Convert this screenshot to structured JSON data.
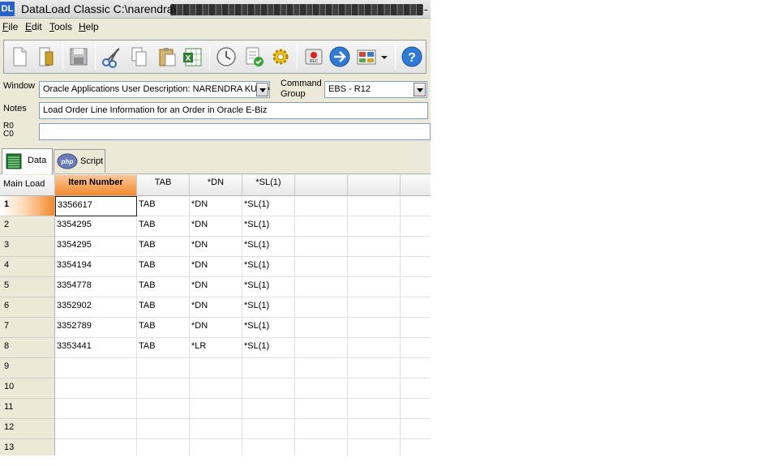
{
  "window": {
    "app_logo": "DL",
    "title": "DataLoad Classic C:\\narendra\\",
    "title_suffix": "-"
  },
  "menu": [
    {
      "label": "File"
    },
    {
      "label": "Edit"
    },
    {
      "label": "Tools"
    },
    {
      "label": "Help"
    }
  ],
  "toolbar": {
    "icons": [
      "new-document-icon",
      "open-icon",
      "save-icon",
      "cut-icon",
      "copy-icon",
      "paste-icon",
      "excel-icon",
      "delay-clock-icon",
      "validate-icon",
      "settings-gear-icon",
      "record-icon",
      "run-arrow-icon",
      "view-options-icon",
      "help-icon"
    ]
  },
  "form": {
    "window_label": "Window",
    "window_value": "Oracle Applications User Description: NARENDRA KUMA",
    "command_group_label_1": "Command",
    "command_group_label_2": "Group",
    "command_group_value": "EBS - R12",
    "notes_label": "Notes",
    "notes_value": "Load Order Line Information for an Order in Oracle E-Biz",
    "row_label": "R0",
    "col_label": "C0",
    "rc_value": ""
  },
  "tabs": [
    {
      "label": "Data",
      "active": true,
      "icon": "data-grid-icon"
    },
    {
      "label": "Script",
      "active": false,
      "icon": "php-icon"
    }
  ],
  "grid": {
    "corner_label": "Main Load",
    "columns": [
      "Item Number",
      "TAB",
      "*DN",
      "*SL(1)",
      "",
      "",
      ""
    ],
    "rows": [
      {
        "num": "1",
        "cells": [
          "3356617",
          "TAB",
          "*DN",
          "*SL(1)",
          "",
          "",
          ""
        ]
      },
      {
        "num": "2",
        "cells": [
          "3354295",
          "TAB",
          "*DN",
          "*SL(1)",
          "",
          "",
          ""
        ]
      },
      {
        "num": "3",
        "cells": [
          "3354295",
          "TAB",
          "*DN",
          "*SL(1)",
          "",
          "",
          ""
        ]
      },
      {
        "num": "4",
        "cells": [
          "3354194",
          "TAB",
          "*DN",
          "*SL(1)",
          "",
          "",
          ""
        ]
      },
      {
        "num": "5",
        "cells": [
          "3354778",
          "TAB",
          "*DN",
          "*SL(1)",
          "",
          "",
          ""
        ]
      },
      {
        "num": "6",
        "cells": [
          "3352902",
          "TAB",
          "*DN",
          "*SL(1)",
          "",
          "",
          ""
        ]
      },
      {
        "num": "7",
        "cells": [
          "3352789",
          "TAB",
          "*DN",
          "*SL(1)",
          "",
          "",
          ""
        ]
      },
      {
        "num": "8",
        "cells": [
          "3353441",
          "TAB",
          "*LR",
          "*SL(1)",
          "",
          "",
          ""
        ]
      },
      {
        "num": "9",
        "cells": [
          "",
          "",
          "",
          "",
          "",
          "",
          ""
        ]
      },
      {
        "num": "10",
        "cells": [
          "",
          "",
          "",
          "",
          "",
          "",
          ""
        ]
      },
      {
        "num": "11",
        "cells": [
          "",
          "",
          "",
          "",
          "",
          "",
          ""
        ]
      },
      {
        "num": "12",
        "cells": [
          "",
          "",
          "",
          "",
          "",
          "",
          ""
        ]
      },
      {
        "num": "13",
        "cells": [
          "",
          "",
          "",
          "",
          "",
          "",
          ""
        ]
      }
    ]
  },
  "colors": {
    "accent_orange": "#f08a2c",
    "title_logo_blue": "#2a62c9",
    "chrome": "#ece9d8"
  }
}
